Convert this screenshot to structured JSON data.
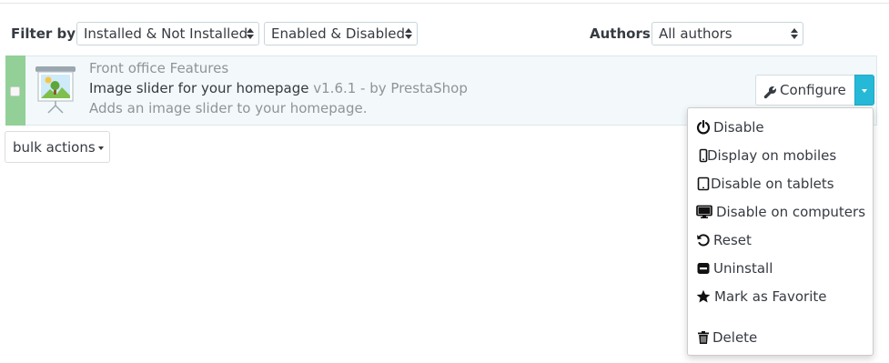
{
  "filters": {
    "filter_by_label": "Filter by",
    "install_status": "Installed & Not Installed",
    "enabled_status": "Enabled & Disabled",
    "authors_label": "Authors",
    "authors_value": "All authors"
  },
  "module": {
    "category": "Front office Features",
    "name": "Image slider for your homepage",
    "version_author": "v1.6.1 - by PrestaShop",
    "description": "Adds an image slider to your homepage.",
    "status_color": "#92d097",
    "icon": "image-slider-icon"
  },
  "actions": {
    "configure_label": "Configure",
    "configure_icon": "wrench-icon",
    "toggle_color": "#25b9d7"
  },
  "bulk_actions_label": "bulk actions",
  "dropdown_items": [
    {
      "label": "Disable",
      "icon": "power-icon"
    },
    {
      "label": "Display on mobiles",
      "icon": "mobile-icon"
    },
    {
      "label": "Disable on tablets",
      "icon": "tablet-icon"
    },
    {
      "label": "Disable on computers",
      "icon": "desktop-icon"
    },
    {
      "label": "Reset",
      "icon": "undo-icon"
    },
    {
      "label": "Uninstall",
      "icon": "minus-square-icon"
    },
    {
      "label": "Mark as Favorite",
      "icon": "star-icon"
    },
    {
      "label": "Delete",
      "icon": "trash-icon"
    }
  ]
}
